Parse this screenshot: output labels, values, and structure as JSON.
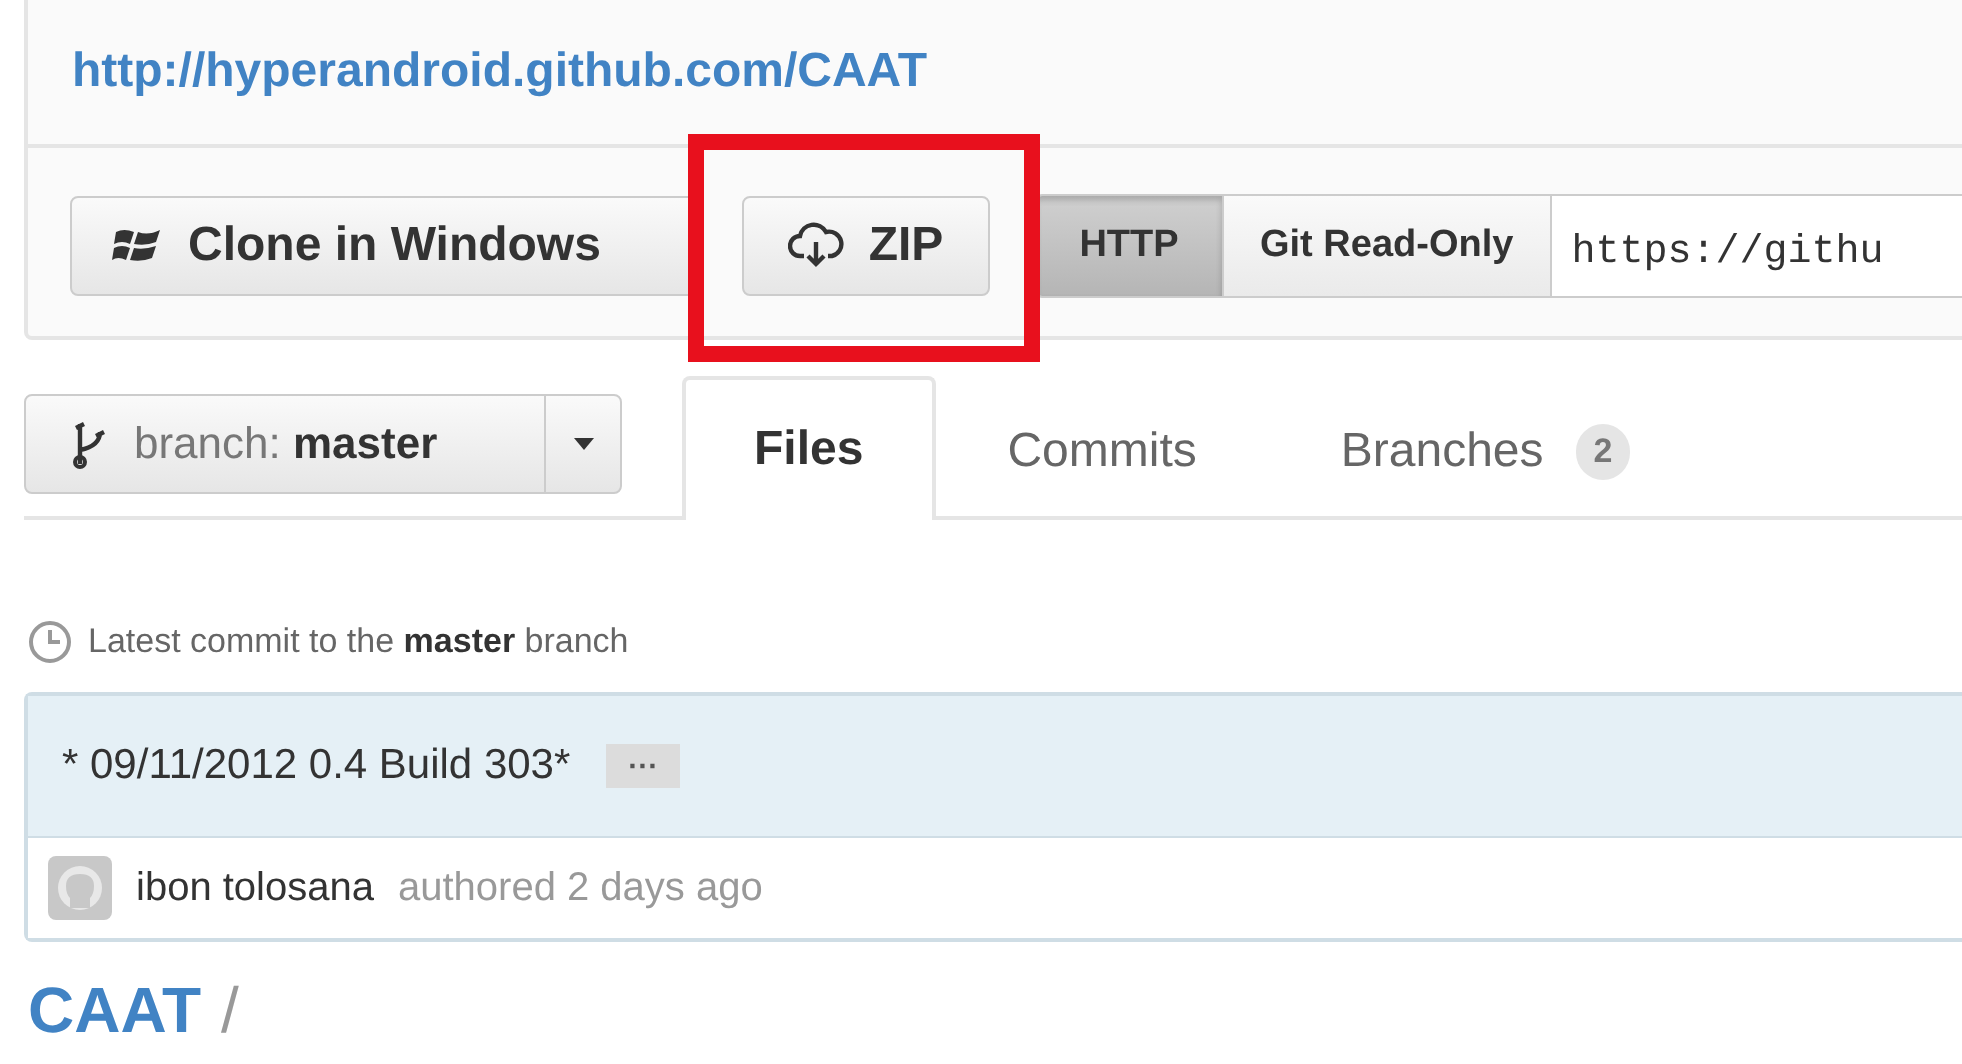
{
  "repo_url": "http://hyperandroid.github.com/CAAT",
  "clone_buttons": [
    {
      "kind": "windows",
      "label": "Clone in Windows",
      "highlighted": false
    },
    {
      "kind": "zip",
      "label": "ZIP",
      "highlighted": true
    }
  ],
  "protocols": [
    {
      "label": "HTTP",
      "selected": true
    },
    {
      "label": "Git Read-Only",
      "selected": false
    }
  ],
  "clone_url": {
    "value": "https://githu"
  },
  "branch": {
    "prefix": "branch:",
    "name": "master"
  },
  "tabs": [
    {
      "label": "Files",
      "selected": true
    },
    {
      "label": "Commits",
      "selected": false
    },
    {
      "label": "Branches",
      "selected": false,
      "count": "2"
    }
  ],
  "latest_commit": {
    "text": "Latest commit to the **master** branch",
    "message": "* 09/11/2012 0.4 Build 303*",
    "more": "···",
    "author": "ibon tolosana",
    "meta": "authored 2 days ago"
  },
  "breadcrumb": {
    "repo": "CAAT",
    "separator": "/"
  }
}
